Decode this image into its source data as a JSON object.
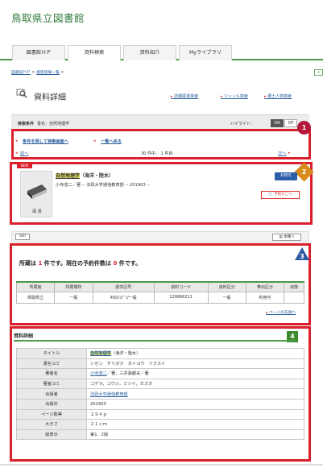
{
  "header": {
    "library_name": "鳥取県立図書館"
  },
  "tabs": [
    "図書館ＨＰ",
    "資料検索",
    "資料紹介",
    "Myライブラリ"
  ],
  "breadcrumb": {
    "items": [
      "図書館ＨＰ",
      "検索結果一覧"
    ],
    "side_button": "+"
  },
  "detail": {
    "title": "資料詳細",
    "links": [
      "詳細蔵書検索",
      "ジャンル検索",
      "郷土人物検索"
    ]
  },
  "condition": {
    "label": "検索条件",
    "value": "書名：自然地理学",
    "highlight_label": "ハイライト：",
    "on": "ON",
    "off": "OF"
  },
  "nav": {
    "back_keep": "条件を残して検索画面へ",
    "back_list": "一覧へ戻る",
    "prev": "前へ",
    "next": "次へ",
    "count": "30 件中、 1 件目"
  },
  "badges": [
    "1",
    "2",
    "3",
    "4"
  ],
  "item": {
    "new_tag": "NEW",
    "media_label": "図 書",
    "title_main": "自然地理学",
    "title_rest": "（海洋・陸水）",
    "subline": "小寺浩二／著 -- 法政大学通信教育部 -- 201903 --",
    "avail": "利用可",
    "cart": "予約かごへ"
  },
  "sdi": {
    "label": "SDI",
    "shelf": "本棚へ"
  },
  "holdings": {
    "summary_a": "所蔵は ",
    "count_hold": "1",
    "summary_b": " 件です。現在の予約件数は ",
    "count_res": "0",
    "summary_c": " 件です。",
    "headers": [
      "所蔵館",
      "所蔵場所",
      "請求記号",
      "資料コード",
      "資料区分",
      "帯出区分",
      "状態"
    ],
    "row": [
      "県取県立",
      "一般",
      "450/ｺﾃﾞﾗ/一般",
      "120666211",
      "一般",
      "利用可",
      ""
    ],
    "page_top": "ページの先頭へ"
  },
  "details": {
    "heading": "資料詳細",
    "rows": [
      {
        "k": "タイトル",
        "v1": "自然地理学",
        "v2": "（海洋・陸水）",
        "hl": true
      },
      {
        "k": "書名ヨミ",
        "v1": "シゼン　チリガク　カイヨウ　リクスイ"
      },
      {
        "k": "著者名",
        "v1": "小寺浩二",
        "v2": "／著，三井嘉都夫／著",
        "link": true
      },
      {
        "k": "著者ヨミ",
        "v1": "コデラ，コウジ，ミツイ，カズオ"
      },
      {
        "k": "出版者",
        "v1": "法政大学通信教育部",
        "link": true
      },
      {
        "k": "出版年",
        "v1": "201903"
      },
      {
        "k": "ページ数等",
        "v1": "２９４ｐ"
      },
      {
        "k": "大きさ",
        "v1": "２１ｃｍ"
      },
      {
        "k": "版表示",
        "v1": "第1．2版"
      }
    ]
  }
}
